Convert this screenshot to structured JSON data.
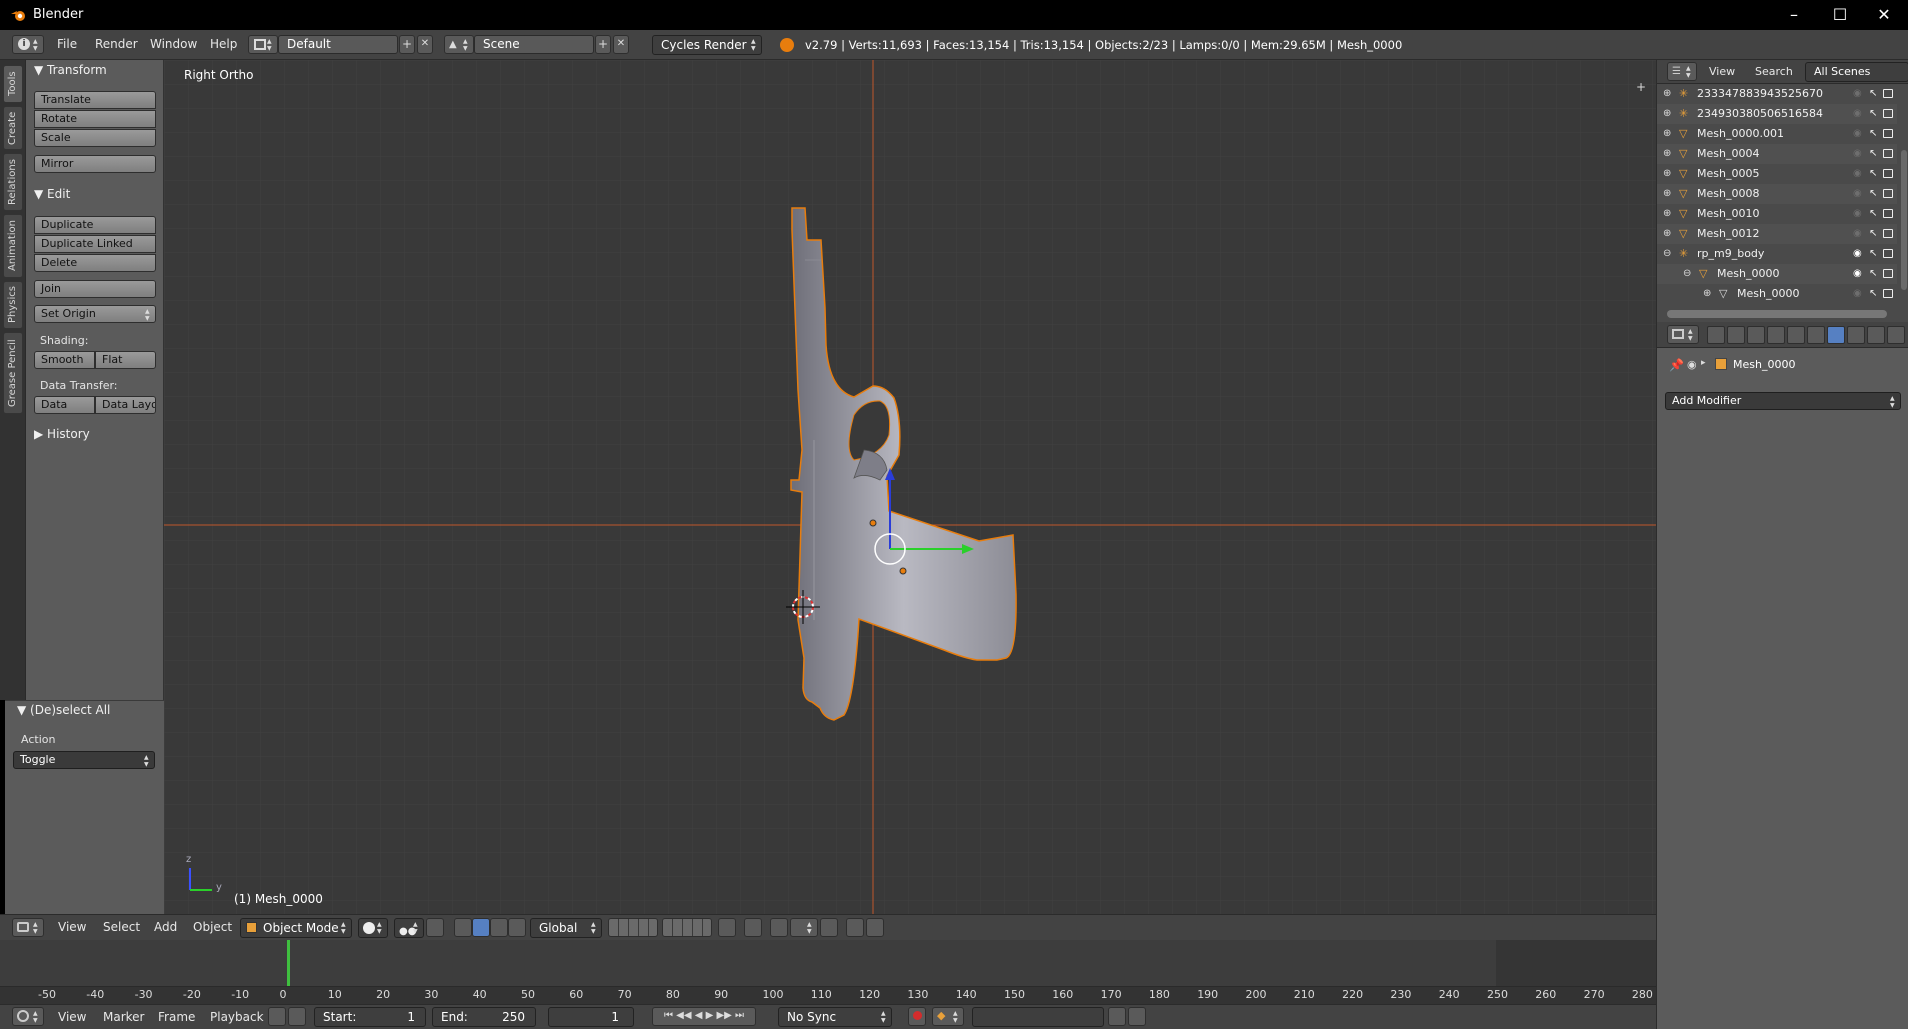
{
  "window": {
    "title": "Blender"
  },
  "info_header": {
    "menus": [
      "File",
      "Render",
      "Window",
      "Help"
    ],
    "layout": "Default",
    "scene": "Scene",
    "engine": "Cycles Render",
    "stats": "v2.79 | Verts:11,693 | Faces:13,154 | Tris:13,154 | Objects:2/23 | Lamps:0/0 | Mem:29.65M | Mesh_0000"
  },
  "left_tabs": [
    "Tools",
    "Create",
    "Relations",
    "Animation",
    "Physics",
    "Grease Pencil"
  ],
  "tool_shelf": {
    "transform": {
      "header": "Transform",
      "buttons": [
        "Translate",
        "Rotate",
        "Scale",
        "Mirror"
      ]
    },
    "edit": {
      "header": "Edit",
      "buttons": [
        "Duplicate",
        "Duplicate Linked",
        "Delete",
        "Join"
      ],
      "set_origin": "Set Origin",
      "shading_label": "Shading:",
      "shading_buttons": [
        "Smooth",
        "Flat"
      ],
      "data_transfer_label": "Data Transfer:",
      "data_buttons": [
        "Data",
        "Data Layo"
      ]
    },
    "history": {
      "header": "History"
    }
  },
  "redo_panel": {
    "header": "(De)select All",
    "action_label": "Action",
    "action_value": "Toggle"
  },
  "viewport": {
    "view_label": "Right Ortho",
    "object_label": "(1) Mesh_0000",
    "axis_z": "z",
    "axis_y": "y"
  },
  "viewport_header": {
    "menus": [
      "View",
      "Select",
      "Add",
      "Object"
    ],
    "mode": "Object Mode",
    "orientation": "Global"
  },
  "timeline": {
    "ruler": [
      "-50",
      "-40",
      "-30",
      "-20",
      "-10",
      "0",
      "10",
      "20",
      "30",
      "40",
      "50",
      "60",
      "70",
      "80",
      "90",
      "100",
      "110",
      "120",
      "130",
      "140",
      "150",
      "160",
      "170",
      "180",
      "190",
      "200",
      "210",
      "220",
      "230",
      "240",
      "250",
      "260",
      "270",
      "280"
    ],
    "menus": [
      "View",
      "Marker",
      "Frame",
      "Playback"
    ],
    "start_label": "Start:",
    "start_value": "1",
    "end_label": "End:",
    "end_value": "250",
    "current_frame": "1",
    "sync": "No Sync"
  },
  "outliner": {
    "menus": [
      "View",
      "Search"
    ],
    "filter": "All Scenes",
    "rows": [
      {
        "name": "233347883943525670",
        "kind": "empty",
        "indent": 0
      },
      {
        "name": "234930380506516584",
        "kind": "empty",
        "indent": 0
      },
      {
        "name": "Mesh_0000.001",
        "kind": "mesh",
        "indent": 0
      },
      {
        "name": "Mesh_0004",
        "kind": "mesh",
        "indent": 0
      },
      {
        "name": "Mesh_0005",
        "kind": "mesh",
        "indent": 0
      },
      {
        "name": "Mesh_0008",
        "kind": "mesh",
        "indent": 0
      },
      {
        "name": "Mesh_0010",
        "kind": "mesh",
        "indent": 0
      },
      {
        "name": "Mesh_0012",
        "kind": "mesh",
        "indent": 0
      },
      {
        "name": "rp_m9_body",
        "kind": "empty",
        "indent": 0
      },
      {
        "name": "Mesh_0000",
        "kind": "mesh",
        "indent": 1
      },
      {
        "name": "Mesh_0000",
        "kind": "meshdata",
        "indent": 2
      }
    ]
  },
  "properties": {
    "object_name": "Mesh_0000",
    "add_modifier": "Add Modifier"
  },
  "colors": {
    "accent": "#e87d0d",
    "bg_dark": "#393939",
    "panel": "#5b5b5b",
    "header": "#434343"
  }
}
